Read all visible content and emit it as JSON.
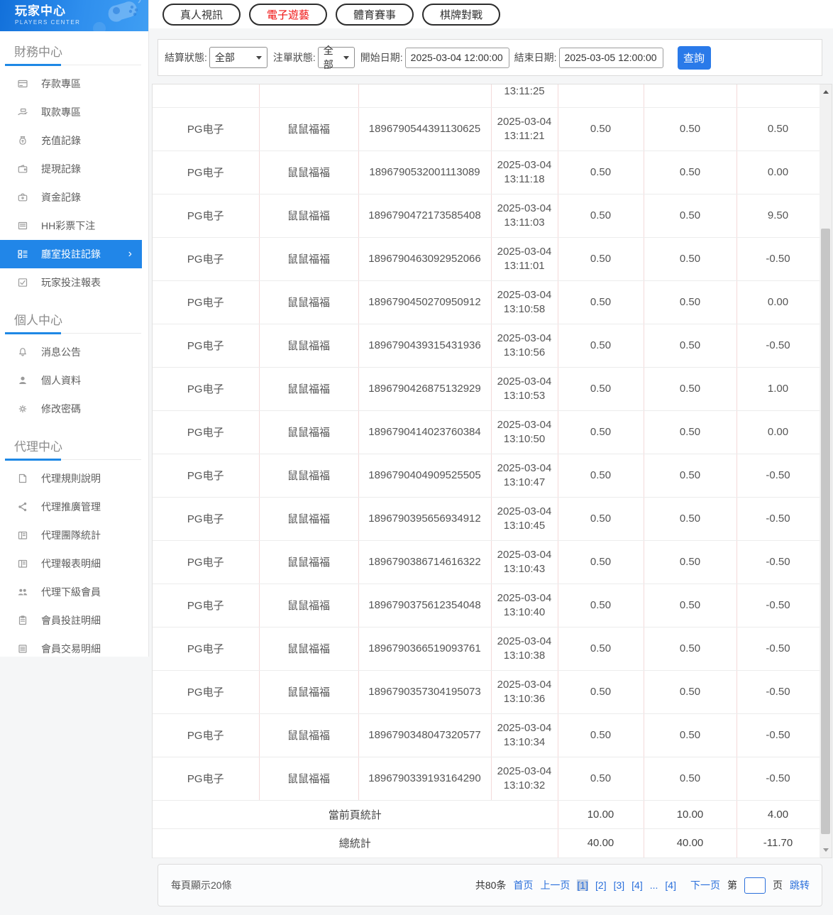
{
  "sidebar": {
    "title": "玩家中心",
    "subtitle": "PLAYERS CENTER",
    "chevron": "›",
    "sections": [
      {
        "title": "財務中心",
        "items": [
          {
            "label": "存款專區",
            "icon": "card-icon"
          },
          {
            "label": "取款專區",
            "icon": "withdraw-hand-icon"
          },
          {
            "label": "充值記錄",
            "icon": "moneybag-icon"
          },
          {
            "label": "提現記錄",
            "icon": "wallet-icon"
          },
          {
            "label": "資金記錄",
            "icon": "purse-icon"
          },
          {
            "label": "HH彩票下注",
            "icon": "lottery-list-icon"
          },
          {
            "label": "廳室投註記錄",
            "icon": "bet-record-icon",
            "active": true
          },
          {
            "label": "玩家投注報表",
            "icon": "report-icon"
          }
        ]
      },
      {
        "title": "個人中心",
        "items": [
          {
            "label": "消息公告",
            "icon": "bell-icon"
          },
          {
            "label": "個人資料",
            "icon": "user-icon"
          },
          {
            "label": "修改密碼",
            "icon": "gear-icon"
          }
        ]
      },
      {
        "title": "代理中心",
        "items": [
          {
            "label": "代理規則說明",
            "icon": "doc-icon"
          },
          {
            "label": "代理推廣管理",
            "icon": "share-icon"
          },
          {
            "label": "代理團隊統計",
            "icon": "team-stats-icon"
          },
          {
            "label": "代理報表明細",
            "icon": "report-detail-icon"
          },
          {
            "label": "代理下級會員",
            "icon": "members-icon"
          },
          {
            "label": "會員投註明細",
            "icon": "member-bets-icon"
          },
          {
            "label": "會員交易明細",
            "icon": "member-trans-icon"
          }
        ]
      }
    ]
  },
  "main": {
    "tabs": [
      {
        "label": "真人視訊"
      },
      {
        "label": "電子遊藝",
        "active": true
      },
      {
        "label": "體育賽事"
      },
      {
        "label": "棋牌對戰"
      }
    ]
  },
  "filters": {
    "settle_label": "結算狀態:",
    "settle_value": "全部",
    "order_label": "注單狀態:",
    "order_value": "全部",
    "start_label": "開始日期:",
    "start_value": "2025-03-04 12:00:00",
    "end_label": "結束日期:",
    "end_value": "2025-03-05 12:00:00",
    "search_button": "查詢"
  },
  "table": {
    "partial_row_time": "13:11:25",
    "rows": [
      {
        "provider": "PG电子",
        "game": "鼠鼠福福",
        "bet_id": "1896790544391130625",
        "date": "2025-03-04",
        "time": "13:11:21",
        "bet": "0.50",
        "valid": "0.50",
        "payout": "0.50"
      },
      {
        "provider": "PG电子",
        "game": "鼠鼠福福",
        "bet_id": "1896790532001113089",
        "date": "2025-03-04",
        "time": "13:11:18",
        "bet": "0.50",
        "valid": "0.50",
        "payout": "0.00"
      },
      {
        "provider": "PG电子",
        "game": "鼠鼠福福",
        "bet_id": "1896790472173585408",
        "date": "2025-03-04",
        "time": "13:11:03",
        "bet": "0.50",
        "valid": "0.50",
        "payout": "9.50"
      },
      {
        "provider": "PG电子",
        "game": "鼠鼠福福",
        "bet_id": "1896790463092952066",
        "date": "2025-03-04",
        "time": "13:11:01",
        "bet": "0.50",
        "valid": "0.50",
        "payout": "-0.50"
      },
      {
        "provider": "PG电子",
        "game": "鼠鼠福福",
        "bet_id": "1896790450270950912",
        "date": "2025-03-04",
        "time": "13:10:58",
        "bet": "0.50",
        "valid": "0.50",
        "payout": "0.00"
      },
      {
        "provider": "PG电子",
        "game": "鼠鼠福福",
        "bet_id": "1896790439315431936",
        "date": "2025-03-04",
        "time": "13:10:56",
        "bet": "0.50",
        "valid": "0.50",
        "payout": "-0.50"
      },
      {
        "provider": "PG电子",
        "game": "鼠鼠福福",
        "bet_id": "1896790426875132929",
        "date": "2025-03-04",
        "time": "13:10:53",
        "bet": "0.50",
        "valid": "0.50",
        "payout": "1.00"
      },
      {
        "provider": "PG电子",
        "game": "鼠鼠福福",
        "bet_id": "1896790414023760384",
        "date": "2025-03-04",
        "time": "13:10:50",
        "bet": "0.50",
        "valid": "0.50",
        "payout": "0.00"
      },
      {
        "provider": "PG电子",
        "game": "鼠鼠福福",
        "bet_id": "1896790404909525505",
        "date": "2025-03-04",
        "time": "13:10:47",
        "bet": "0.50",
        "valid": "0.50",
        "payout": "-0.50"
      },
      {
        "provider": "PG电子",
        "game": "鼠鼠福福",
        "bet_id": "1896790395656934912",
        "date": "2025-03-04",
        "time": "13:10:45",
        "bet": "0.50",
        "valid": "0.50",
        "payout": "-0.50"
      },
      {
        "provider": "PG电子",
        "game": "鼠鼠福福",
        "bet_id": "1896790386714616322",
        "date": "2025-03-04",
        "time": "13:10:43",
        "bet": "0.50",
        "valid": "0.50",
        "payout": "-0.50"
      },
      {
        "provider": "PG电子",
        "game": "鼠鼠福福",
        "bet_id": "1896790375612354048",
        "date": "2025-03-04",
        "time": "13:10:40",
        "bet": "0.50",
        "valid": "0.50",
        "payout": "-0.50"
      },
      {
        "provider": "PG电子",
        "game": "鼠鼠福福",
        "bet_id": "1896790366519093761",
        "date": "2025-03-04",
        "time": "13:10:38",
        "bet": "0.50",
        "valid": "0.50",
        "payout": "-0.50"
      },
      {
        "provider": "PG电子",
        "game": "鼠鼠福福",
        "bet_id": "1896790357304195073",
        "date": "2025-03-04",
        "time": "13:10:36",
        "bet": "0.50",
        "valid": "0.50",
        "payout": "-0.50"
      },
      {
        "provider": "PG电子",
        "game": "鼠鼠福福",
        "bet_id": "1896790348047320577",
        "date": "2025-03-04",
        "time": "13:10:34",
        "bet": "0.50",
        "valid": "0.50",
        "payout": "-0.50"
      },
      {
        "provider": "PG电子",
        "game": "鼠鼠福福",
        "bet_id": "1896790339193164290",
        "date": "2025-03-04",
        "time": "13:10:32",
        "bet": "0.50",
        "valid": "0.50",
        "payout": "-0.50"
      }
    ],
    "summary": [
      {
        "label": "當前頁統計",
        "bet": "10.00",
        "valid": "10.00",
        "payout": "4.00"
      },
      {
        "label": "總統計",
        "bet": "40.00",
        "valid": "40.00",
        "payout": "-11.70"
      }
    ]
  },
  "pagination": {
    "per_page": "每頁顯示20條",
    "total": "共80条",
    "first": "首页",
    "prev": "上一页",
    "pages": [
      {
        "label": "[1]",
        "current": true
      },
      {
        "label": "[2]"
      },
      {
        "label": "[3]"
      },
      {
        "label": "[4]"
      },
      {
        "label": "...",
        "ellipsis": true
      },
      {
        "label": "[4]"
      }
    ],
    "next": "下一页",
    "jump_prefix": "第",
    "jump_suffix": "页",
    "jump_button": "跳转"
  },
  "colors": {
    "accent_blue": "#2186e8",
    "button_blue": "#2a7ae9",
    "active_tab_red": "#f01212",
    "link_blue": "#2a6fdb",
    "current_page_bg": "#c3cfe2",
    "cell_border_pink": "#f3dada"
  }
}
